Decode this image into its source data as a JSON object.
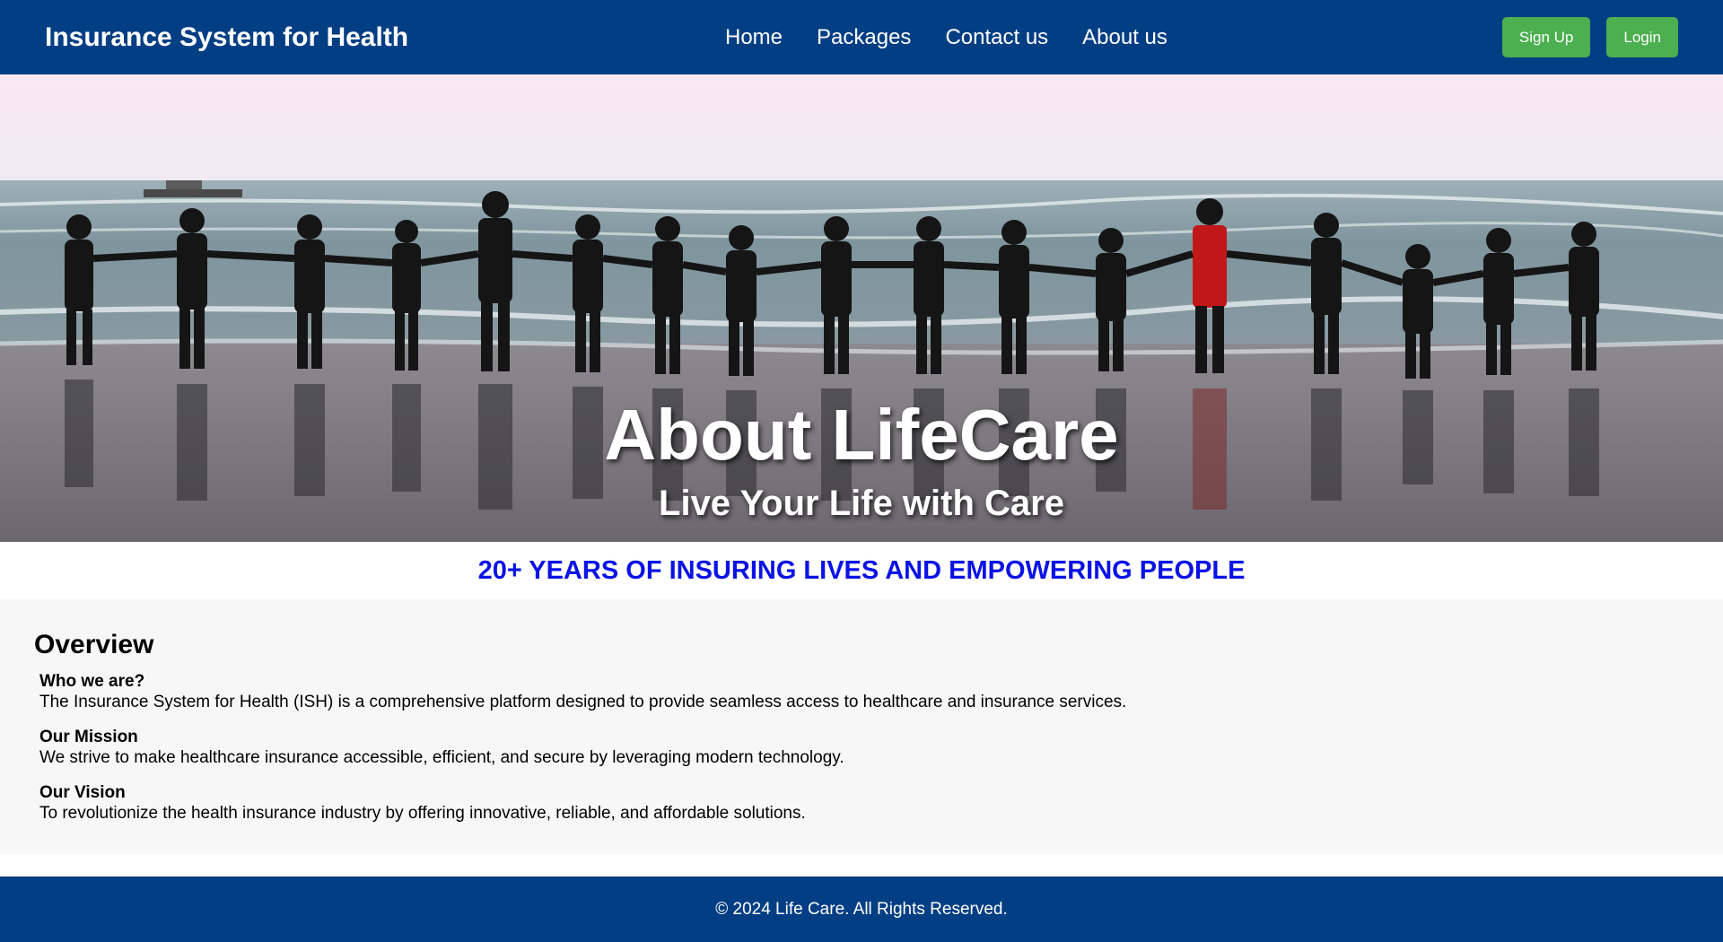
{
  "navbar": {
    "brand": "Insurance System for Health",
    "links": [
      "Home",
      "Packages",
      "Contact us",
      "About us"
    ],
    "signup_label": "Sign Up",
    "login_label": "Login",
    "background_color": "#023e84",
    "button_color": "#4caf50"
  },
  "hero": {
    "title": "About LifeCare",
    "subtitle": "Live Your Life with Care",
    "image": "beach-people-holding-hands-photo"
  },
  "tagline": {
    "text": "20+ YEARS OF INSURING LIVES AND EMPOWERING PEOPLE",
    "color": "#0a12e6"
  },
  "overview": {
    "title": "Overview",
    "items": [
      {
        "heading": "Who we are?",
        "text": "The Insurance System for Health (ISH) is a comprehensive platform designed to provide seamless access to healthcare and insurance services."
      },
      {
        "heading": "Our Mission",
        "text": "We strive to make healthcare insurance accessible, efficient, and secure by leveraging modern technology."
      },
      {
        "heading": "Our Vision",
        "text": "To revolutionize the health insurance industry by offering innovative, reliable, and affordable solutions."
      }
    ]
  },
  "footer": {
    "text": "© 2024 Life Care. All Rights Reserved."
  }
}
